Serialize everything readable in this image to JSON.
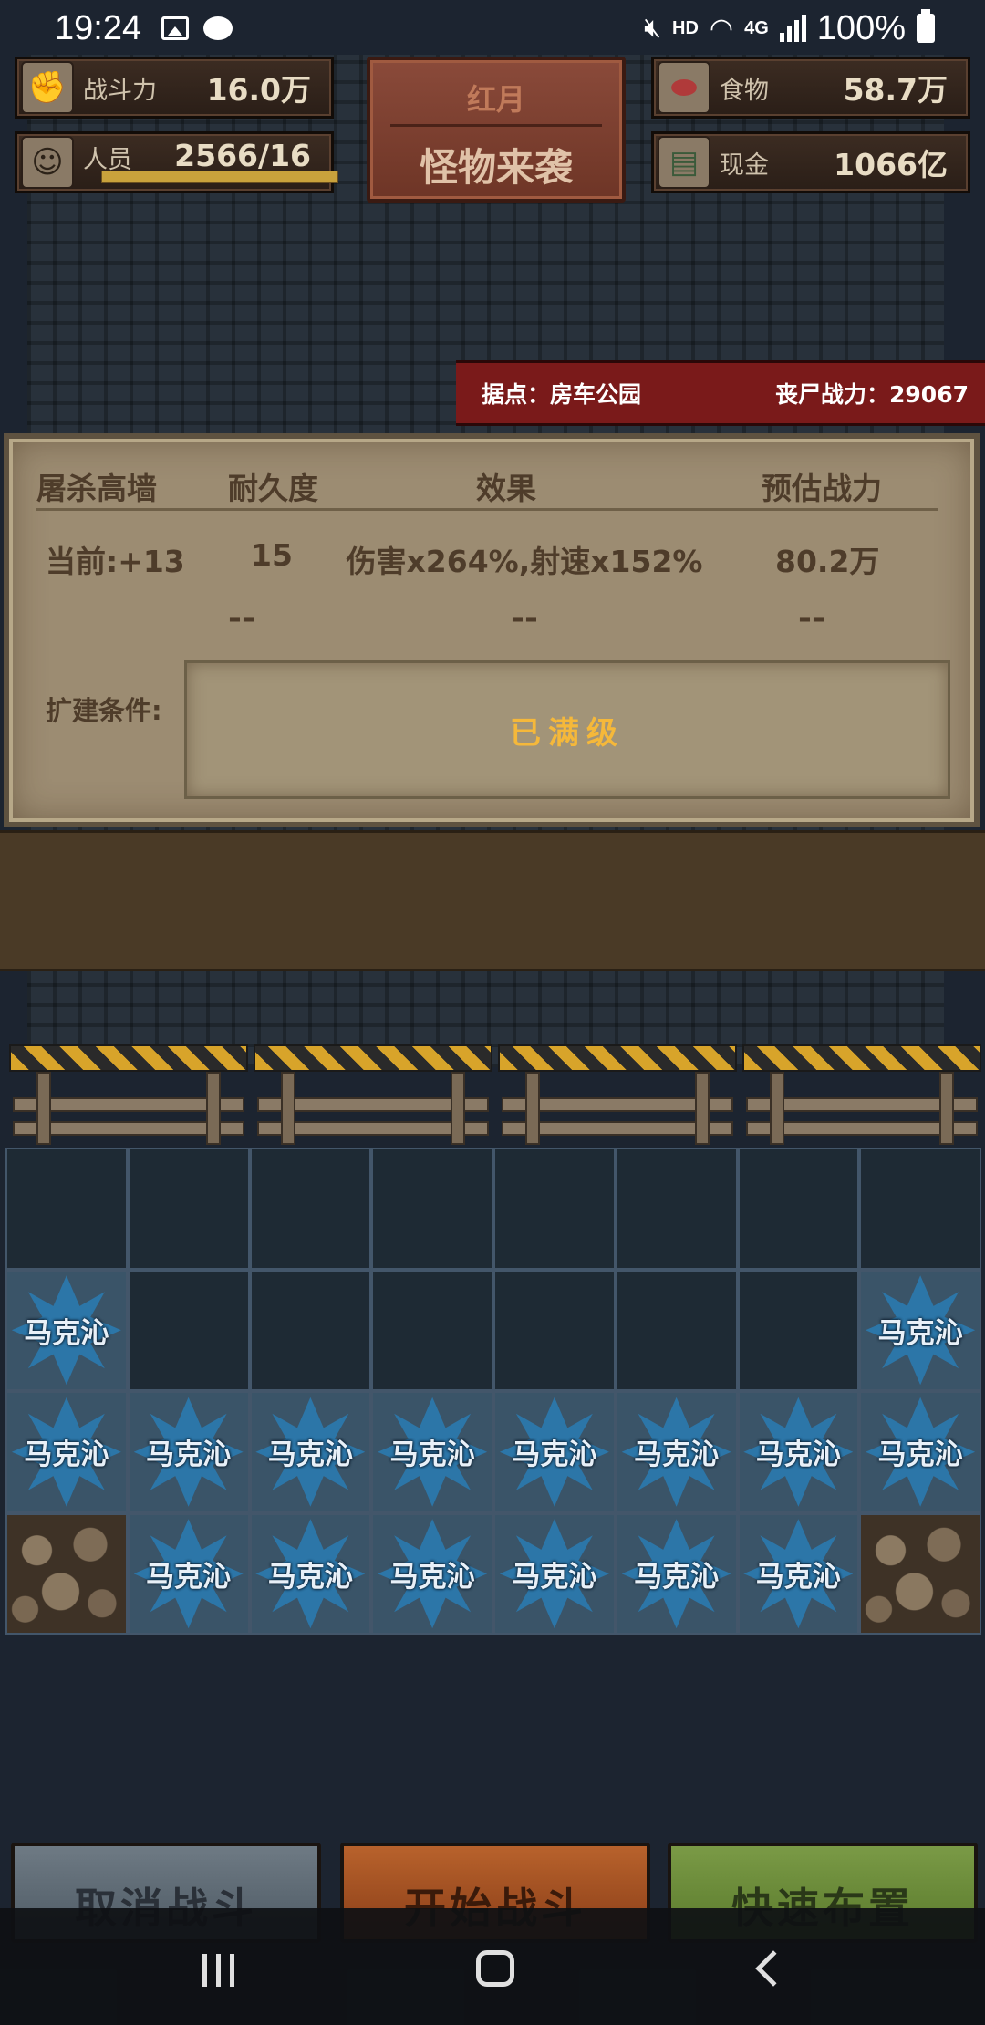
{
  "status_bar": {
    "time": "19:24",
    "hd": "HD",
    "net": "4G",
    "battery": "100%"
  },
  "resources": {
    "combat_power": {
      "label": "战斗力",
      "value": "16.0万",
      "icon": "fist-icon"
    },
    "personnel": {
      "label": "人员",
      "value": "2566/16",
      "icon": "person-icon"
    },
    "food": {
      "label": "食物",
      "value": "58.7万",
      "icon": "meat-icon"
    },
    "cash": {
      "label": "现金",
      "value": "1066亿",
      "icon": "money-icon"
    }
  },
  "event": {
    "small_title": "红月",
    "big_title": "怪物来袭"
  },
  "base": {
    "name": "据点：房车公园",
    "zombie_power": "丧尸战力：29067"
  },
  "wall": {
    "headers": [
      "屠杀高墙",
      "耐久度",
      "效果",
      "预估战力"
    ],
    "current": {
      "level": "当前:+13",
      "durability": "15",
      "effect": "伤害x264%,射速x152%",
      "power": "80.2万"
    },
    "next": {
      "durability": "--",
      "effect": "--",
      "power": "--"
    },
    "condition_label": "扩建条件:",
    "condition_value": "已满级"
  },
  "grid": {
    "unit_name": "马克沁",
    "rows": [
      [
        "empty",
        "empty",
        "empty",
        "empty",
        "empty",
        "empty",
        "empty",
        "empty"
      ],
      [
        "unit",
        "empty",
        "empty",
        "empty",
        "empty",
        "empty",
        "empty",
        "unit"
      ],
      [
        "unit",
        "unit",
        "unit",
        "unit",
        "unit",
        "unit",
        "unit",
        "unit"
      ],
      [
        "rock",
        "unit",
        "unit",
        "unit",
        "unit",
        "unit",
        "unit",
        "rock"
      ]
    ]
  },
  "buttons": {
    "cancel": "取消战斗",
    "start": "开始战斗",
    "quick": "快速布置"
  },
  "colors": {
    "unit_star": "#2c76a8",
    "max_level_text": "#f5b83a",
    "banner_red": "#7a1a1a"
  }
}
